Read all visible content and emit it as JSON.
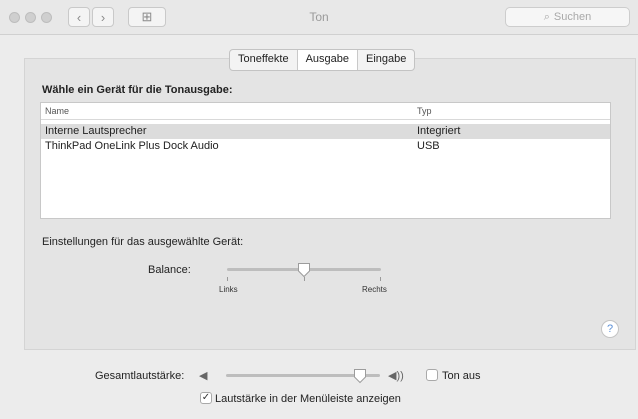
{
  "window": {
    "title": "Ton",
    "back_glyph": "‹",
    "forward_glyph": "›",
    "grid_glyph": "⊞",
    "search_placeholder": "Suchen",
    "search_glyph": "⌕"
  },
  "tabs": [
    {
      "label": "Toneffekte",
      "selected": false
    },
    {
      "label": "Ausgabe",
      "selected": true
    },
    {
      "label": "Eingabe",
      "selected": false
    }
  ],
  "output": {
    "heading": "Wähle ein Gerät für die Tonausgabe:",
    "columns": {
      "name": "Name",
      "type": "Typ"
    },
    "devices": [
      {
        "name": "Interne Lautsprecher",
        "type": "Integriert",
        "selected": true
      },
      {
        "name": "ThinkPad OneLink Plus Dock Audio",
        "type": "USB",
        "selected": false
      }
    ],
    "settings_heading": "Einstellungen für das ausgewählte Gerät:",
    "balance": {
      "label": "Balance:",
      "left_label": "Links",
      "right_label": "Rechts",
      "value": 0.5
    }
  },
  "help_glyph": "?",
  "volume": {
    "label": "Gesamtlautstärke:",
    "low_icon_glyph": "◀",
    "high_icon_glyph": "◀))",
    "value": 0.87,
    "mute_label": "Ton aus",
    "mute_checked": false,
    "menubar_label": "Lautstärke in der Menüleiste anzeigen",
    "menubar_checked": true,
    "check_glyph": "✓"
  },
  "colors": {
    "selection": "#dcdcdc",
    "help_accent": "#5b8fd6"
  }
}
